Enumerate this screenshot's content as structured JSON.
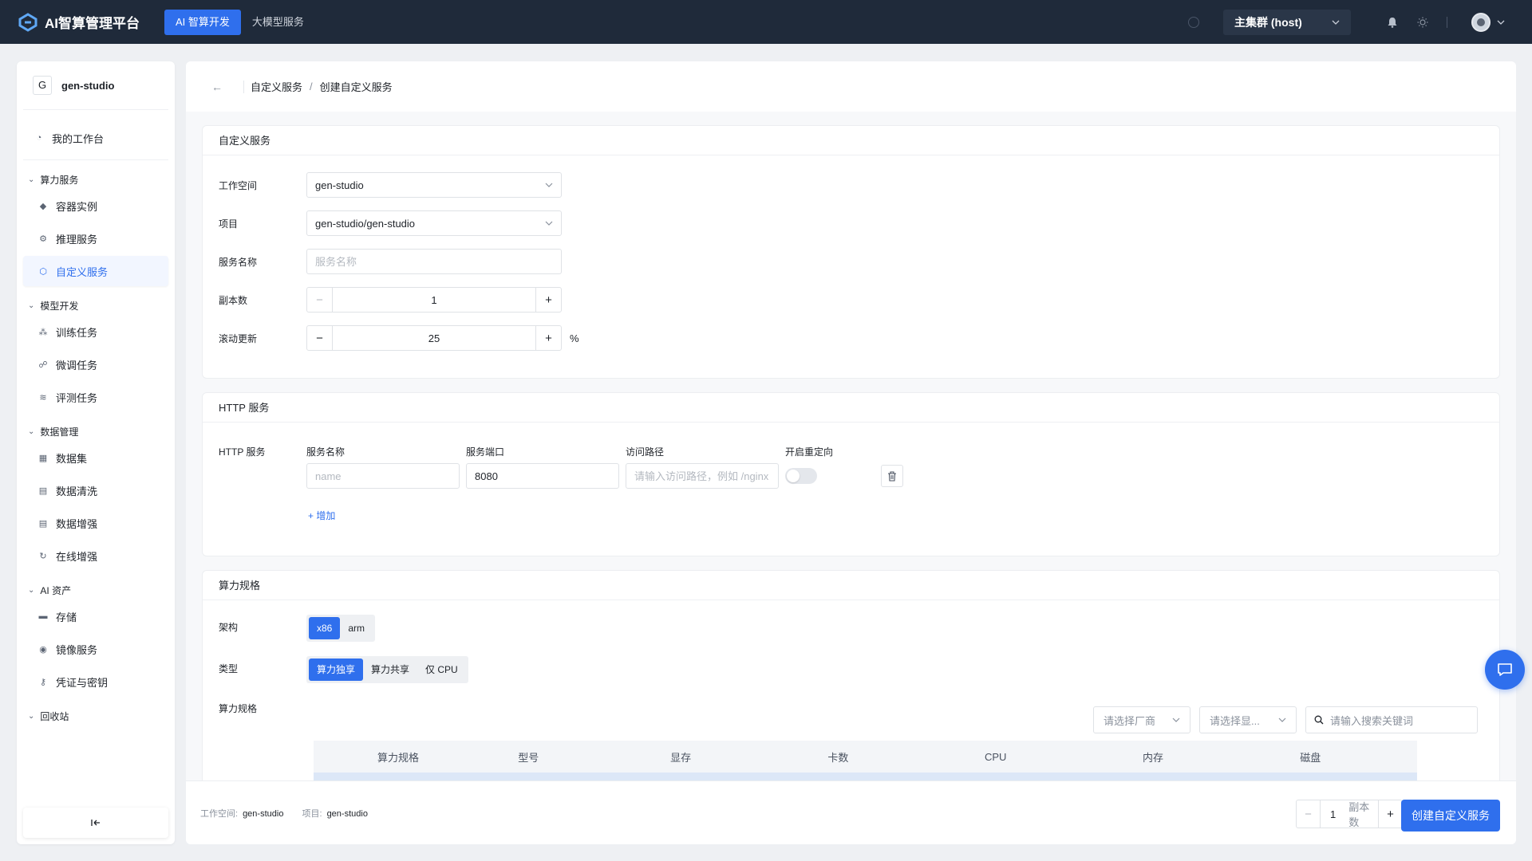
{
  "app": {
    "title": "AI智算管理平台",
    "nav": [
      {
        "label": "AI 智算开发",
        "active": true
      },
      {
        "label": "大模型服务",
        "active": false
      }
    ],
    "cluster": "主集群 (host)"
  },
  "sidebar": {
    "workspace_badge": "G",
    "workspace_name": "gen-studio",
    "top_item": "我的工作台",
    "groups": [
      {
        "title": "算力服务",
        "items": [
          "容器实例",
          "推理服务",
          "自定义服务"
        ]
      },
      {
        "title": "模型开发",
        "items": [
          "训练任务",
          "微调任务",
          "评测任务"
        ]
      },
      {
        "title": "数据管理",
        "items": [
          "数据集",
          "数据清洗",
          "数据增强",
          "在线增强"
        ]
      },
      {
        "title": "AI 资产",
        "items": [
          "存储",
          "镜像服务",
          "凭证与密钥"
        ]
      },
      {
        "title": "回收站",
        "items": []
      }
    ],
    "active_item": "自定义服务",
    "collapse_icon": "collapse-left-icon"
  },
  "breadcrumb": [
    "自定义服务",
    "创建自定义服务"
  ],
  "custom_service": {
    "title": "自定义服务",
    "workspace_label": "工作空间",
    "workspace_value": "gen-studio",
    "project_label": "项目",
    "project_value": "gen-studio/gen-studio",
    "name_label": "服务名称",
    "name_placeholder": "服务名称",
    "replicas_label": "副本数",
    "replicas_value": "1",
    "rolling_label": "滚动更新",
    "rolling_value": "25",
    "rolling_suffix": "%"
  },
  "http_service": {
    "title": "HTTP 服务",
    "row_label": "HTTP 服务",
    "col_name": "服务名称",
    "col_port": "服务端口",
    "col_path": "访问路径",
    "col_redirect": "开启重定向",
    "name_placeholder": "name",
    "port_value": "8080",
    "path_placeholder": "请输入访问路径，例如 /nginx",
    "redirect_enabled": false,
    "add_label": "+ 增加"
  },
  "compute_spec": {
    "title": "算力规格",
    "arch_label": "架构",
    "arch_options": [
      {
        "label": "x86",
        "active": true
      },
      {
        "label": "arm",
        "active": false
      }
    ],
    "type_label": "类型",
    "type_options": [
      {
        "label": "算力独享",
        "active": true
      },
      {
        "label": "算力共享",
        "active": false
      },
      {
        "label": "仅 CPU",
        "active": false
      }
    ],
    "spec_label": "算力规格",
    "vendor_placeholder": "请选择厂商",
    "gpu_placeholder": "请选择显...",
    "search_placeholder": "请输入搜索关键词",
    "columns": [
      "算力规格",
      "型号",
      "显存",
      "卡数",
      "CPU",
      "内存",
      "磁盘"
    ]
  },
  "footer": {
    "workspace_label": "工作空间:",
    "workspace_value": "gen-studio",
    "project_label": "项目:",
    "project_value": "gen-studio",
    "replicas_value": "1",
    "replicas_unit": "副本数",
    "submit_label": "创建自定义服务"
  },
  "colors": {
    "accent": "#2f6fed",
    "topbar": "#1f2a3a"
  }
}
